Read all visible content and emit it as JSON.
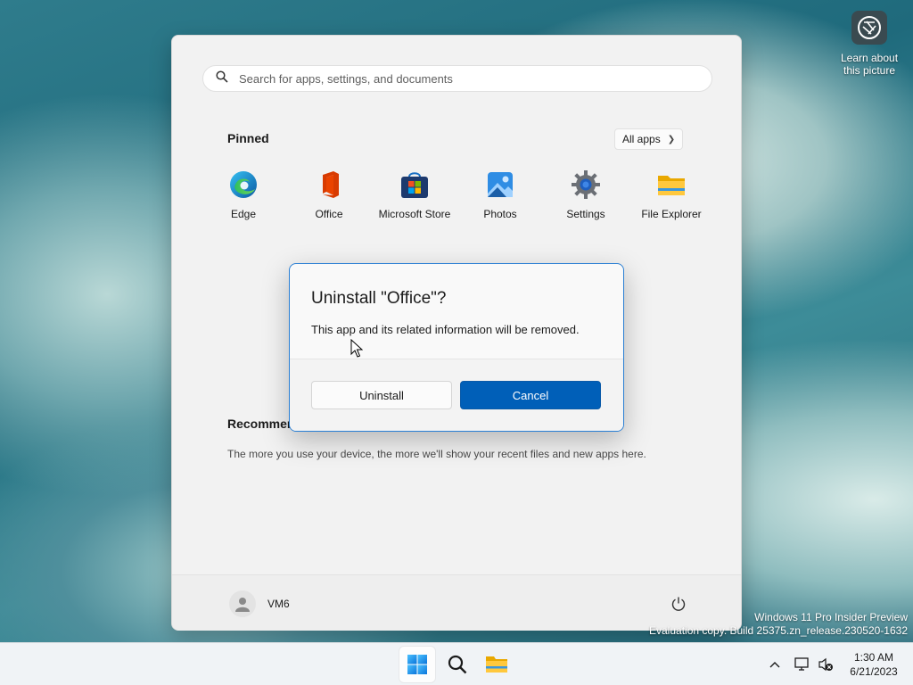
{
  "desktop": {
    "widget_label": "Learn about this picture",
    "watermark_line1": "Windows 11 Pro Insider Preview",
    "watermark_line2": "Evaluation copy. Build 25375.zn_release.230520-1632"
  },
  "start_menu": {
    "search_placeholder": "Search for apps, settings, and documents",
    "pinned_title": "Pinned",
    "all_apps_label": "All apps",
    "pinned_apps": [
      {
        "label": "Edge",
        "icon": "edge-icon"
      },
      {
        "label": "Office",
        "icon": "office-icon"
      },
      {
        "label": "Microsoft Store",
        "icon": "store-icon"
      },
      {
        "label": "Photos",
        "icon": "photos-icon"
      },
      {
        "label": "Settings",
        "icon": "settings-icon"
      },
      {
        "label": "File Explorer",
        "icon": "folder-icon"
      }
    ],
    "recommended_title": "Recommended",
    "recommended_text": "The more you use your device, the more we'll show your recent files and new apps here.",
    "user_name": "VM6"
  },
  "dialog": {
    "title": "Uninstall \"Office\"?",
    "message": "This app and its related information will be removed.",
    "uninstall_label": "Uninstall",
    "cancel_label": "Cancel"
  },
  "taskbar": {
    "time": "1:30 AM",
    "date": "6/21/2023"
  },
  "colors": {
    "accent": "#005fb8",
    "dialog_border": "#2a7fd4"
  }
}
